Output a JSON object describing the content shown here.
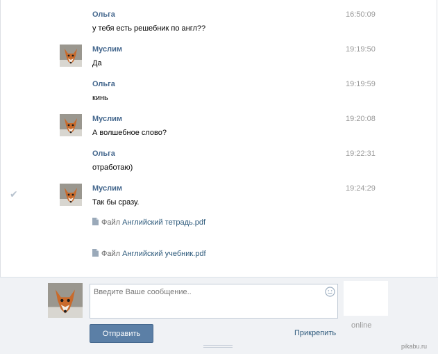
{
  "messages": [
    {
      "author": "Ольга",
      "time": "16:50:09",
      "text": "у тебя есть решебник по англ??",
      "avatar": false,
      "read_check": false,
      "attachments": []
    },
    {
      "author": "Муслим",
      "time": "19:19:50",
      "text": "Да",
      "avatar": true,
      "read_check": false,
      "attachments": []
    },
    {
      "author": "Ольга",
      "time": "19:19:59",
      "text": "кинь",
      "avatar": false,
      "read_check": false,
      "attachments": []
    },
    {
      "author": "Муслим",
      "time": "19:20:08",
      "text": "А волшебное слово?",
      "avatar": true,
      "read_check": false,
      "attachments": []
    },
    {
      "author": "Ольга",
      "time": "19:22:31",
      "text": "отработаю)",
      "avatar": false,
      "read_check": false,
      "attachments": []
    },
    {
      "author": "Муслим",
      "time": "19:24:29",
      "text": "Так бы сразу.",
      "avatar": true,
      "read_check": true,
      "attachments": [
        {
          "prefix": "Файл",
          "name": "Английский тетрадь.pdf"
        },
        {
          "prefix": "Файл",
          "name": "Английский учебник.pdf"
        }
      ]
    }
  ],
  "icons": {
    "read_check": "check-icon",
    "attachment": "document-icon",
    "emoji": "smile-icon"
  },
  "composer": {
    "placeholder": "Введите Ваше сообщение..",
    "send_label": "Отправить",
    "attach_label": "Прикрепить",
    "status": "online"
  },
  "watermark": "pikabu.ru",
  "colors": {
    "author": "#45688e",
    "link": "#2b587a",
    "time": "#999999",
    "button": "#5b7fa6",
    "composer_bg": "#f0f2f5"
  }
}
